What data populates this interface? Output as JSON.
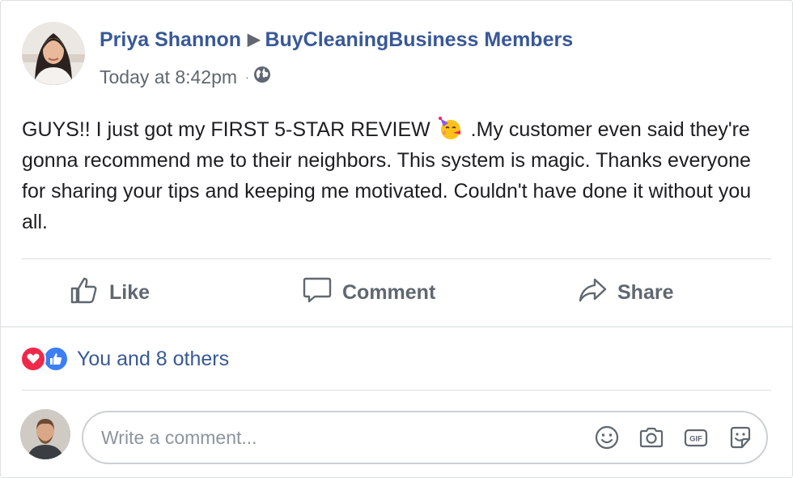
{
  "post": {
    "author": "Priya Shannon",
    "group": "BuyCleaningBusiness Members",
    "timestamp": "Today at 8:42pm",
    "privacy_icon": "globe-icon",
    "text_part1": "GUYS!! I just got my FIRST 5-STAR REVIEW",
    "emoji": "partying-face-emoji",
    "text_part2": ".My customer even said they're gonna recommend me to their neighbors. This system is magic. Thanks everyone for sharing your tips and keeping me motivated. Couldn't have done it without you all."
  },
  "actions": {
    "like_label": "Like",
    "comment_label": "Comment",
    "share_label": "Share"
  },
  "reactions": {
    "icons": [
      "heart-icon",
      "thumbs-up-icon"
    ],
    "summary": "You and 8 others"
  },
  "comment_box": {
    "placeholder": "Write a comment...",
    "value": "",
    "icons": [
      "emoji-icon",
      "camera-icon",
      "gif-icon",
      "sticker-icon"
    ]
  },
  "colors": {
    "link": "#385898",
    "secondary_text": "#606770",
    "heart": "#f0284a",
    "like": "#3b7ef5",
    "divider": "#dadde1"
  }
}
